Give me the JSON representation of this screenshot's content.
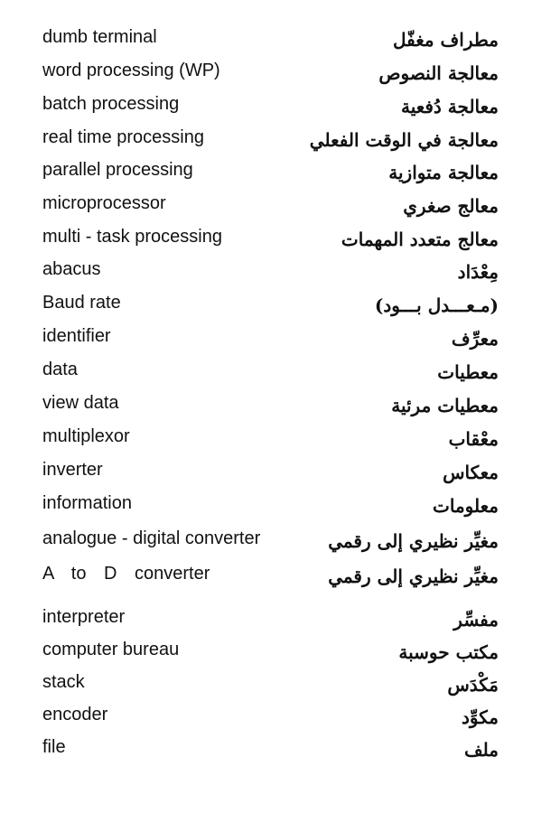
{
  "entries": [
    {
      "en": "dumb terminal",
      "ar": "مطراف مغفّل"
    },
    {
      "en": "word processing (WP)",
      "ar": "معالجة النصوص"
    },
    {
      "en": "batch processing",
      "ar": "معالجة دُفعية"
    },
    {
      "en": "real time processing",
      "ar": "معالجة في الوقت الفعلي"
    },
    {
      "en": "parallel processing",
      "ar": "معالجة متوازية"
    },
    {
      "en": "microprocessor",
      "ar": "معالج صغري"
    },
    {
      "en": "multi - task processing",
      "ar": "معالج متعدد المهمات"
    },
    {
      "en": "abacus",
      "ar": "مِعْدَاد"
    },
    {
      "en": "Baud rate",
      "ar": "(مـعـــدل بـــود)"
    },
    {
      "en": "identifier",
      "ar": "معرِّف"
    },
    {
      "en": "data",
      "ar": "معطيات"
    },
    {
      "en": "view data",
      "ar": "معطيات مرئية"
    },
    {
      "en": "multiplexor",
      "ar": "معْقاب"
    },
    {
      "en": "inverter",
      "ar": "معكاس"
    },
    {
      "en": "information",
      "ar": "معلومات"
    },
    {
      "en": "analogue - digital converter",
      "ar": "مغيِّر نظيري إلى رقمي"
    },
    {
      "en": "A to D converter",
      "ar": "مغيِّر نظيري إلى رقمي"
    },
    {
      "en": "interpreter",
      "ar": "مفسِّر"
    },
    {
      "en": "computer bureau",
      "ar": "مكتب حوسبة"
    },
    {
      "en": "stack",
      "ar": "مَكْدَس"
    },
    {
      "en": "encoder",
      "ar": "مكوِّد"
    },
    {
      "en": "file",
      "ar": "ملف"
    }
  ]
}
